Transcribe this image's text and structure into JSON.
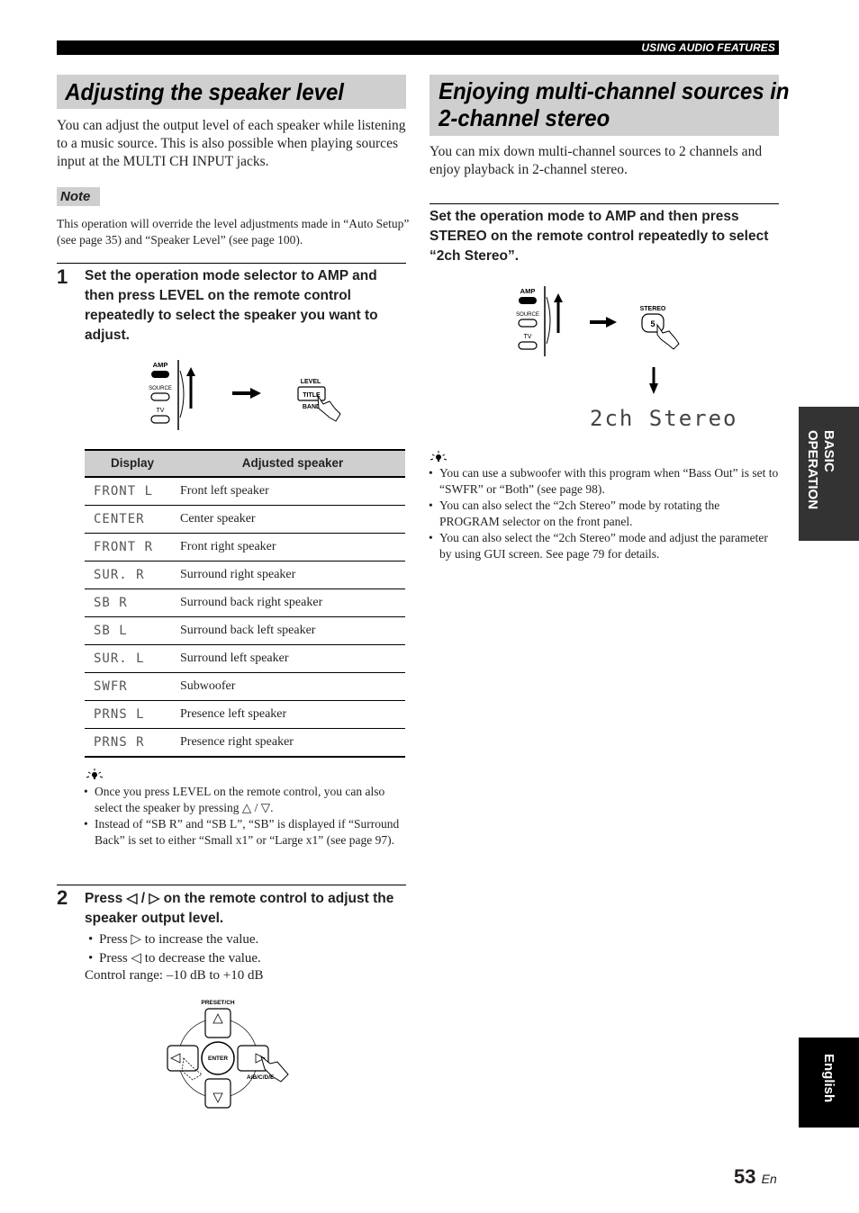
{
  "header": {
    "section": "USING AUDIO FEATURES"
  },
  "left": {
    "title": "Adjusting the speaker level",
    "intro": "You can adjust the output level of each speaker while listening to a music source. This is also possible when playing sources input at the MULTI CH INPUT jacks.",
    "note_label": "Note",
    "note_text": "This operation will override the level adjustments made in “Auto Setup” (see page 35) and “Speaker Level” (see page 100).",
    "step1": {
      "number": "1",
      "text": "Set the operation mode selector to AMP and then press LEVEL on the remote control repeatedly to select the speaker you want to adjust.",
      "illustration": {
        "selector_labels": [
          "AMP",
          "SOURCE",
          "TV"
        ],
        "button_top": "LEVEL",
        "button_main": "TITLE",
        "button_bottom": "BAND"
      }
    },
    "table": {
      "headers": [
        "Display",
        "Adjusted speaker"
      ],
      "rows": [
        {
          "display": "FRONT L",
          "speaker": "Front left speaker"
        },
        {
          "display": "CENTER",
          "speaker": "Center speaker"
        },
        {
          "display": "FRONT R",
          "speaker": "Front right speaker"
        },
        {
          "display": "SUR. R",
          "speaker": "Surround right speaker"
        },
        {
          "display": "SB R",
          "speaker": "Surround back right speaker"
        },
        {
          "display": "SB L",
          "speaker": "Surround back left speaker"
        },
        {
          "display": "SUR. L",
          "speaker": "Surround left speaker"
        },
        {
          "display": "SWFR",
          "speaker": "Subwoofer"
        },
        {
          "display": "PRNS L",
          "speaker": "Presence left speaker"
        },
        {
          "display": "PRNS R",
          "speaker": "Presence right speaker"
        }
      ]
    },
    "tips": [
      "Once you press LEVEL on the remote control, you can also select the speaker by pressing △ / ▽.",
      "Instead of “SB R” and “SB L”, “SB” is displayed if “Surround Back” is set to either “Small x1” or “Large x1” (see page 97)."
    ],
    "step2": {
      "number": "2",
      "text": "Press ◁ / ▷ on the remote control to adjust the speaker output level.",
      "bullets": [
        "Press ▷ to increase the value.",
        "Press ◁ to decrease the value."
      ],
      "range": "Control range: –10 dB to +10 dB",
      "illustration": {
        "top_label": "PRESET/CH",
        "center": "ENTER",
        "side_label": "A/B/C/D/E"
      }
    }
  },
  "right": {
    "title_line1": "Enjoying multi-channel sources in",
    "title_line2": "2-channel stereo",
    "intro": "You can mix down multi-channel sources to 2 channels and enjoy playback in 2-channel stereo.",
    "step": {
      "text": "Set the operation mode to AMP and then press STEREO on the remote control repeatedly to select “2ch Stereo”."
    },
    "illustration": {
      "selector_labels": [
        "AMP",
        "SOURCE",
        "TV"
      ],
      "button_label": "STEREO",
      "button_number": "5",
      "display": "2ch Stereo"
    },
    "tips": [
      "You can use a subwoofer with this program when “Bass Out” is set to “SWFR” or “Both” (see page 98).",
      "You can also select the “2ch Stereo” mode by rotating the PROGRAM selector on the front panel.",
      "You can also select the “2ch Stereo” mode and adjust the parameter by using GUI screen. See page 79 for details."
    ]
  },
  "side_tabs": {
    "section": "BASIC OPERATION",
    "section_line1": "BASIC",
    "section_line2": "OPERATION",
    "language": "English"
  },
  "footer": {
    "page": "53",
    "lang": "En"
  },
  "colors": {
    "heading_band": "#cfcfcf",
    "side_tab_dark": "#333333",
    "side_tab_black": "#000000"
  }
}
